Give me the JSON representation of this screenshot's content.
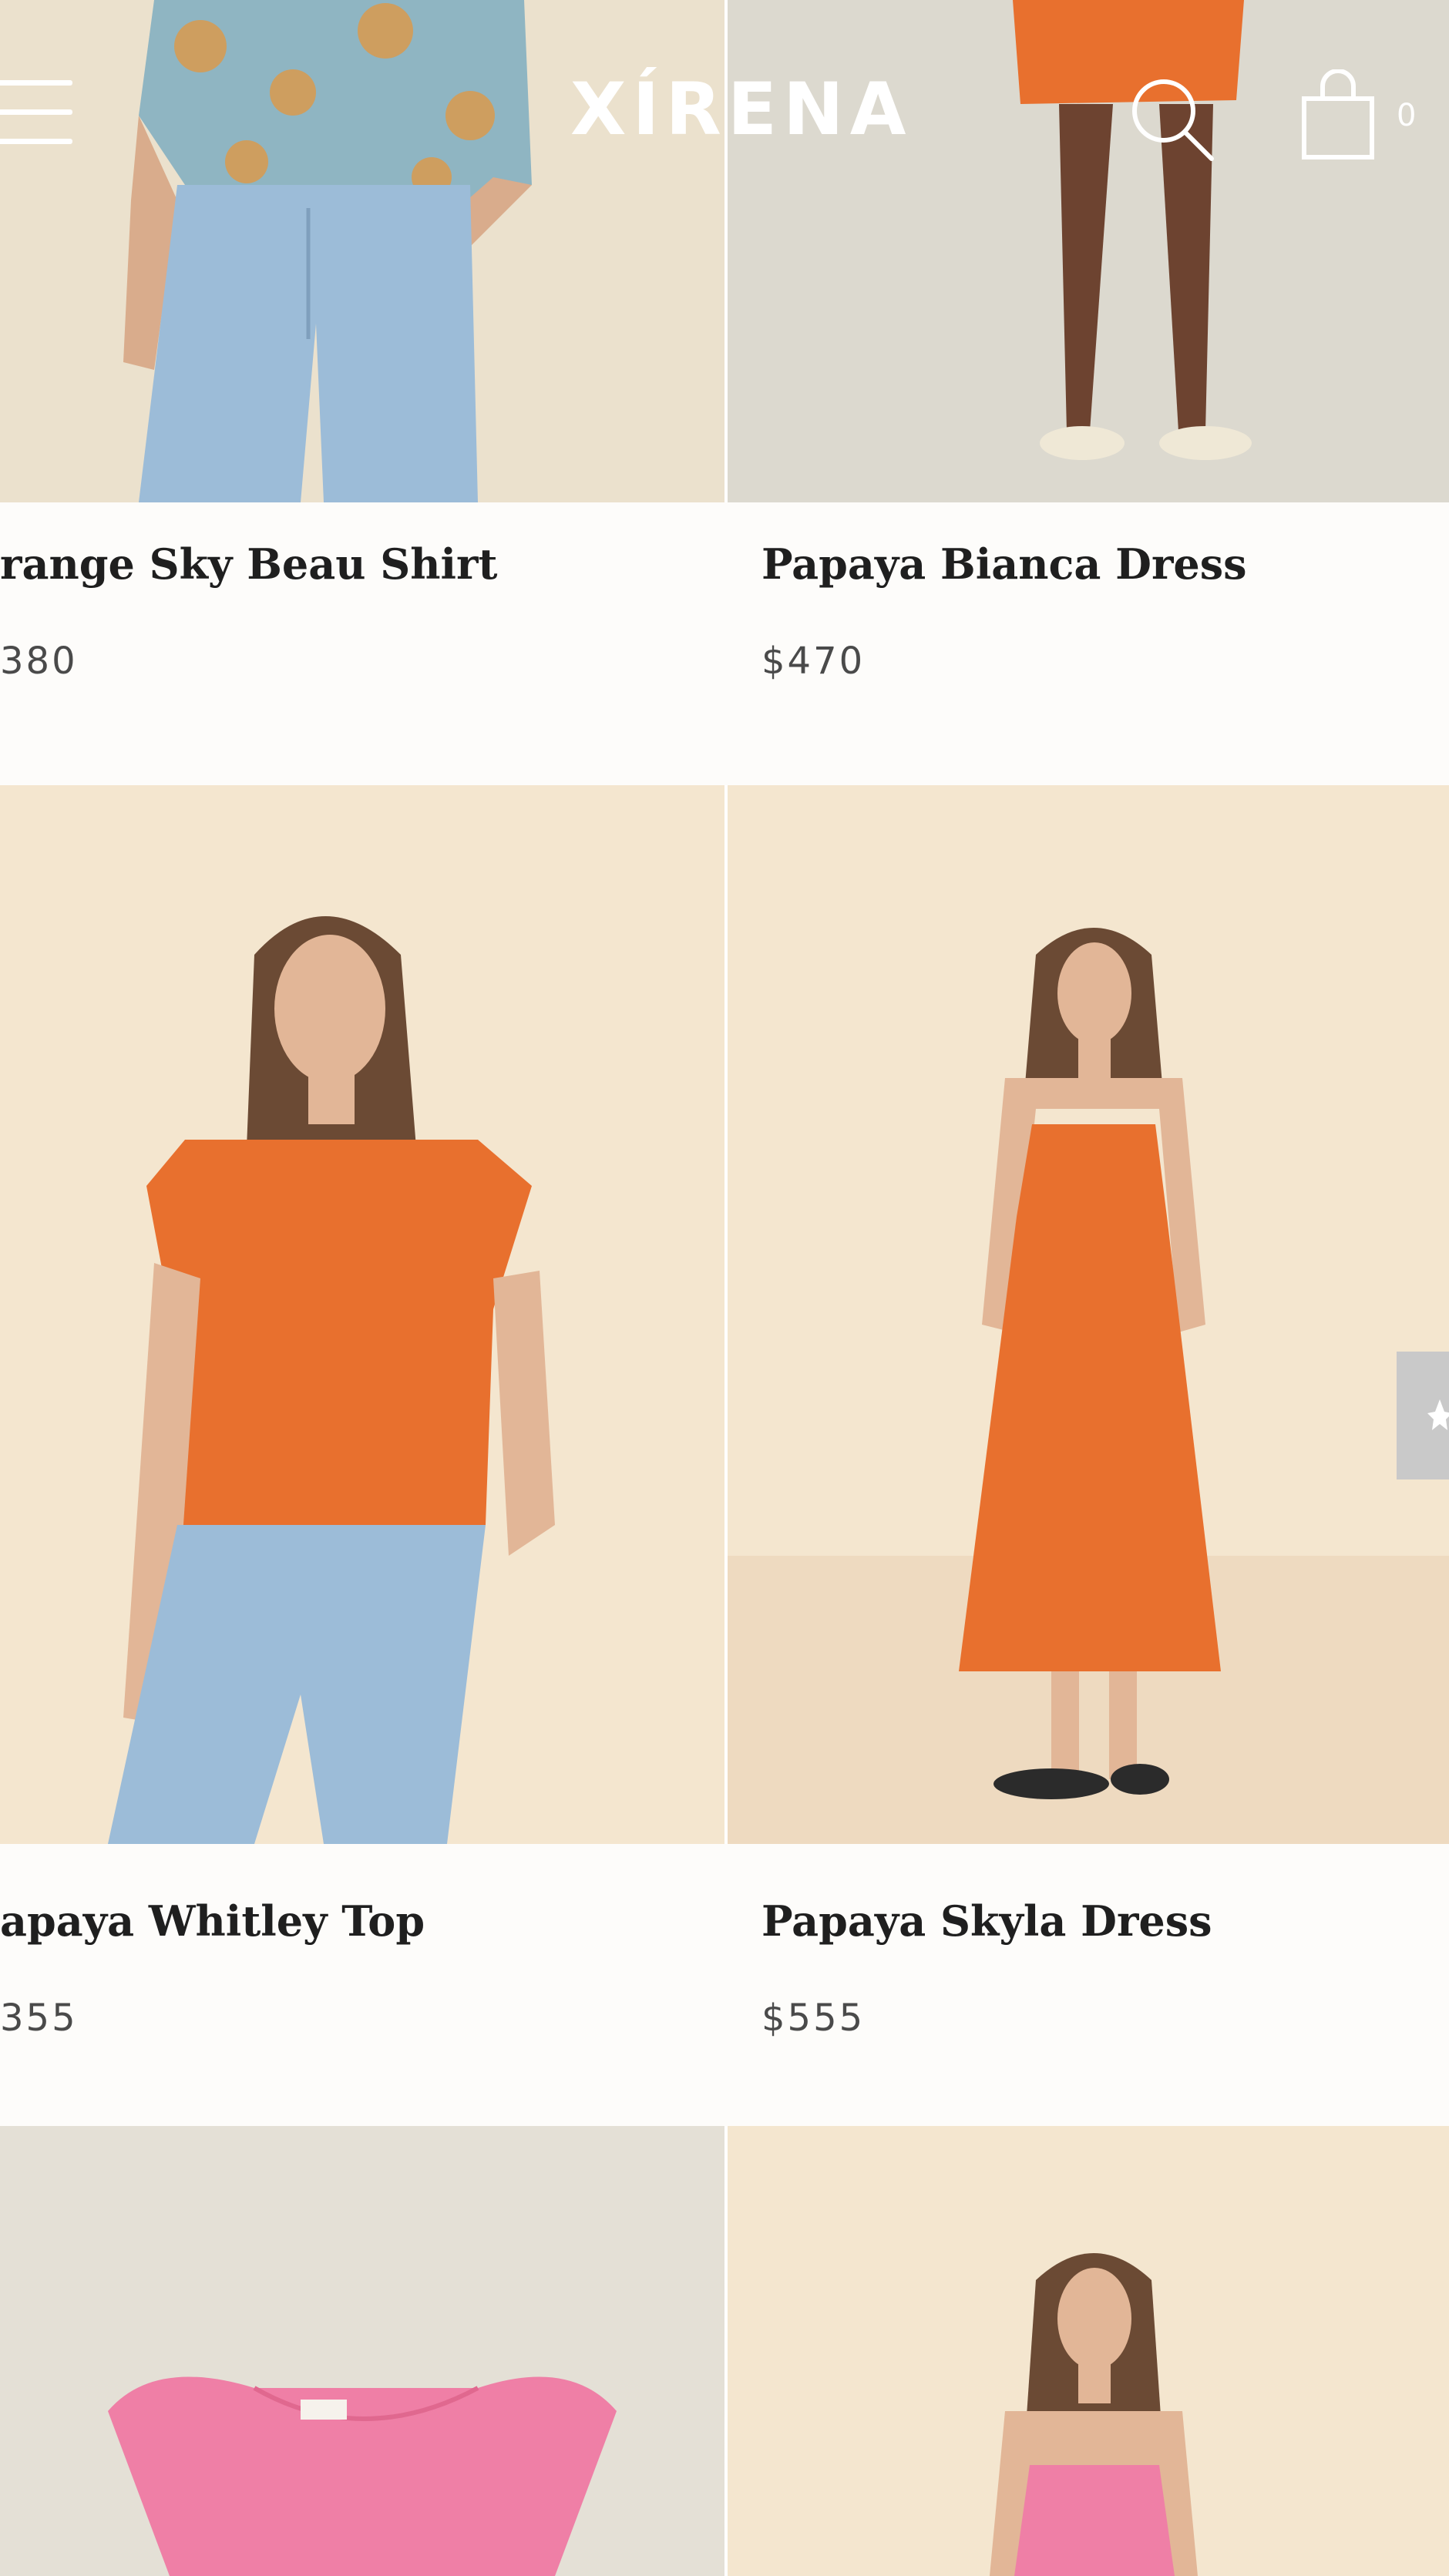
{
  "header": {
    "logo_text": "XÍRENA",
    "cart_count": "0",
    "icons": [
      "menu-icon",
      "search-icon",
      "shopping-bag-icon"
    ]
  },
  "products": [
    {
      "name": "range Sky Beau Shirt",
      "price": "380"
    },
    {
      "name": "Papaya Bianca Dress",
      "price": "$470"
    },
    {
      "name": "apaya Whitley Top",
      "price": "355"
    },
    {
      "name": "Papaya Skyla Dress",
      "price": "$555"
    }
  ],
  "colors": {
    "page_bg": "#fdfcfa",
    "orange": "#e8702e",
    "pink": "#ef7fa6",
    "denim": "#9cbcd8",
    "sand_bg": "#f4e6cf"
  }
}
